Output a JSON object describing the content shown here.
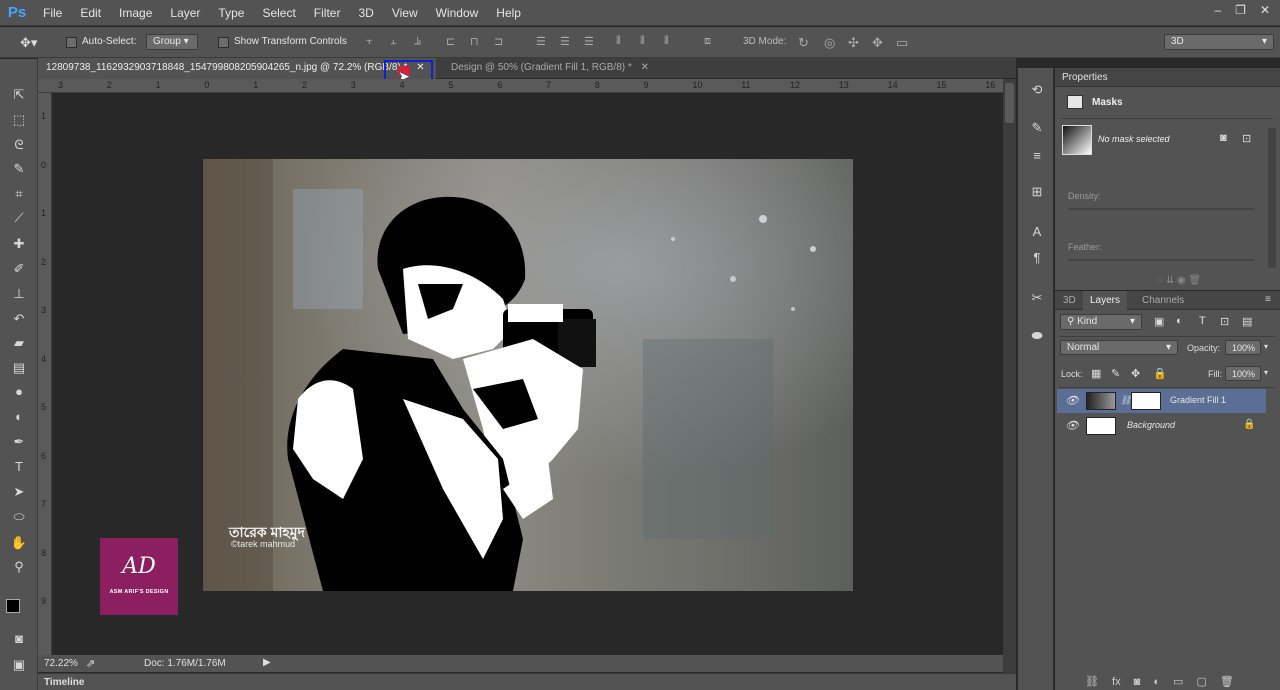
{
  "app": {
    "logo": "Ps"
  },
  "menu": [
    "File",
    "Edit",
    "Image",
    "Layer",
    "Type",
    "Select",
    "Filter",
    "3D",
    "View",
    "Window",
    "Help"
  ],
  "window_controls": {
    "minimize": "–",
    "restore": "❐",
    "close": "✕"
  },
  "options": {
    "auto_select_label": "Auto-Select:",
    "auto_select_value": "Group",
    "show_transform_label": "Show Transform Controls",
    "mode_label": "3D Mode:",
    "workspace": "3D"
  },
  "tabs": [
    {
      "label": "12809738_1162932903718848_1547998082059042​65_n.jpg @ 72.2% (RGB/8) *",
      "close": "✕"
    },
    {
      "label": "Design @ 50% (Gradient Fill 1, RGB/8) *",
      "close": "✕"
    }
  ],
  "ruler_h_ticks": [
    "3",
    "2",
    "1",
    "0",
    "1",
    "2",
    "3",
    "4",
    "5",
    "6",
    "7",
    "8",
    "9",
    "10",
    "11",
    "12",
    "13",
    "14",
    "15",
    "16"
  ],
  "ruler_v_ticks": [
    "1",
    "0",
    "1",
    "2",
    "3",
    "4",
    "5",
    "6",
    "7",
    "8",
    "9"
  ],
  "watermark": {
    "bangla": "তারেক মাহমুদ",
    "latin": "©tarek mahmud"
  },
  "logo_badge": {
    "mark": "AD",
    "text": "ASM ARIF'S DESIGN",
    "color": "#8b1f60"
  },
  "status": {
    "zoom": "72.22%",
    "doc": "Doc: 1.76M/1.76M"
  },
  "timeline": {
    "label": "Timeline"
  },
  "properties": {
    "title": "Properties",
    "section": "Masks",
    "no_mask": "No mask selected",
    "density_label": "Density:",
    "feather_label": "Feather:"
  },
  "layers_panel": {
    "tabs": [
      "3D",
      "Layers",
      "Channels"
    ],
    "kind_label": "Kind",
    "blend_mode": "Normal",
    "opacity_label": "Opacity:",
    "opacity_value": "100%",
    "lock_label": "Lock:",
    "fill_label": "Fill:",
    "fill_value": "100%",
    "layers": [
      {
        "name": "Gradient Fill 1",
        "selected": true
      },
      {
        "name": "Background",
        "selected": false
      }
    ]
  },
  "colors": {
    "accent": "#4aa3ff",
    "highlight_box": "#1020d8",
    "selected_layer": "#5b6f96"
  }
}
